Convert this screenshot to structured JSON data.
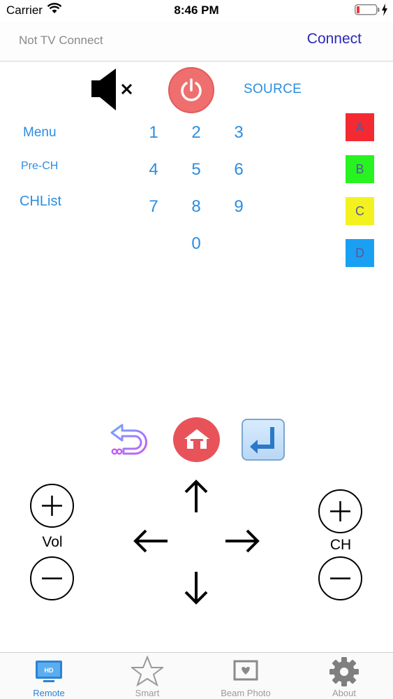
{
  "status_bar": {
    "carrier": "Carrier",
    "time": "8:46 PM"
  },
  "nav": {
    "status": "Not TV Connect",
    "connect_label": "Connect"
  },
  "controls": {
    "source_label": "SOURCE",
    "menu_label": "Menu",
    "prech_label": "Pre-CH",
    "chlist_label": "CHList"
  },
  "numpad": [
    "1",
    "2",
    "3",
    "4",
    "5",
    "6",
    "7",
    "8",
    "9",
    "0"
  ],
  "color_buttons": [
    {
      "label": "A",
      "color": "#f42a32"
    },
    {
      "label": "B",
      "color": "#27f320"
    },
    {
      "label": "C",
      "color": "#f3f21e"
    },
    {
      "label": "D",
      "color": "#1aa0f3"
    }
  ],
  "volume": {
    "label": "Vol"
  },
  "channel": {
    "label": "CH"
  },
  "tabs": [
    {
      "label": "Remote",
      "icon": "tv-hd-icon",
      "active": true
    },
    {
      "label": "Smart",
      "icon": "star-icon",
      "active": false
    },
    {
      "label": "Beam Photo",
      "icon": "photo-frame-icon",
      "active": false
    },
    {
      "label": "About",
      "icon": "gear-icon",
      "active": false
    }
  ],
  "colors": {
    "accent": "#2c8de0",
    "power": "#ef6f6f",
    "home": "#e8535a",
    "connect": "#2a29b8"
  }
}
